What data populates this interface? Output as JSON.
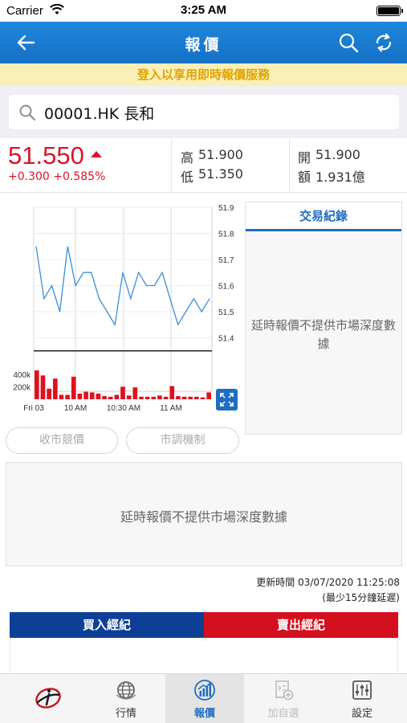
{
  "status_bar": {
    "carrier": "Carrier",
    "time": "3:25 AM"
  },
  "nav": {
    "title": "報價",
    "back_icon": "back-arrow-icon",
    "search_icon": "search-icon",
    "refresh_icon": "refresh-icon"
  },
  "banner": {
    "text": "登入以享用即時報價服務"
  },
  "search": {
    "value": "00001.HK 長和"
  },
  "quote": {
    "price": "51.550",
    "change": "+0.300 +0.585%",
    "high_label": "高",
    "high_value": "51.900",
    "low_label": "低",
    "low_value": "51.350",
    "open_label": "開",
    "open_value": "51.900",
    "turnover_label": "額",
    "turnover_value": "1.931億"
  },
  "chart_data": {
    "type": "line",
    "x_ticks": [
      "Fri 03",
      "10 AM",
      "10:30 AM",
      "11 AM"
    ],
    "y_ticks": [
      "51.9",
      "51.8",
      "51.7",
      "51.6",
      "51.5",
      "51.4"
    ],
    "ylim": [
      51.3,
      51.9
    ],
    "reference_line": 51.35,
    "price_series": [
      51.75,
      51.55,
      51.6,
      51.5,
      51.75,
      51.6,
      51.65,
      51.65,
      51.55,
      51.5,
      51.45,
      51.65,
      51.55,
      51.65,
      51.6,
      51.6,
      51.65,
      51.55,
      51.45,
      51.5,
      51.55,
      51.5,
      51.55
    ],
    "volume_ticks": [
      "400k",
      "200k"
    ],
    "volume_max": 500000,
    "volume_series": [
      460000,
      380000,
      170000,
      330000,
      70000,
      70000,
      360000,
      90000,
      120000,
      110000,
      90000,
      50000,
      40000,
      70000,
      200000,
      60000,
      190000,
      40000,
      40000,
      40000,
      60000,
      40000,
      210000,
      50000,
      40000,
      40000,
      40000,
      30000,
      110000
    ]
  },
  "trade_panel": {
    "tab_label": "交易紀錄",
    "message": "延時報價不提供市場深度數據"
  },
  "buttons": {
    "closing_auction": "收市競價",
    "volatility_mechanism": "市調機制"
  },
  "depth": {
    "message": "延時報價不提供市場深度數據"
  },
  "update": {
    "text": "更新時間 03/07/2020 11:25:08",
    "delay_note": "(最少15分鐘延遲)"
  },
  "broker": {
    "buy_label": "買入經紀",
    "sell_label": "賣出經紀"
  },
  "tabs": [
    {
      "label": "",
      "icon": "logo-icon"
    },
    {
      "label": "行情",
      "icon": "globe-icon"
    },
    {
      "label": "報價",
      "icon": "quote-chart-icon"
    },
    {
      "label": "加自選",
      "icon": "add-watchlist-icon"
    },
    {
      "label": "設定",
      "icon": "settings-icon"
    }
  ],
  "colors": {
    "nav_blue": "#1570c5",
    "up_red": "#d8152b",
    "buy_blue": "#0d3f96",
    "sell_red": "#d4101e",
    "banner_bg": "#fbefb8",
    "banner_text": "#e0a400"
  }
}
